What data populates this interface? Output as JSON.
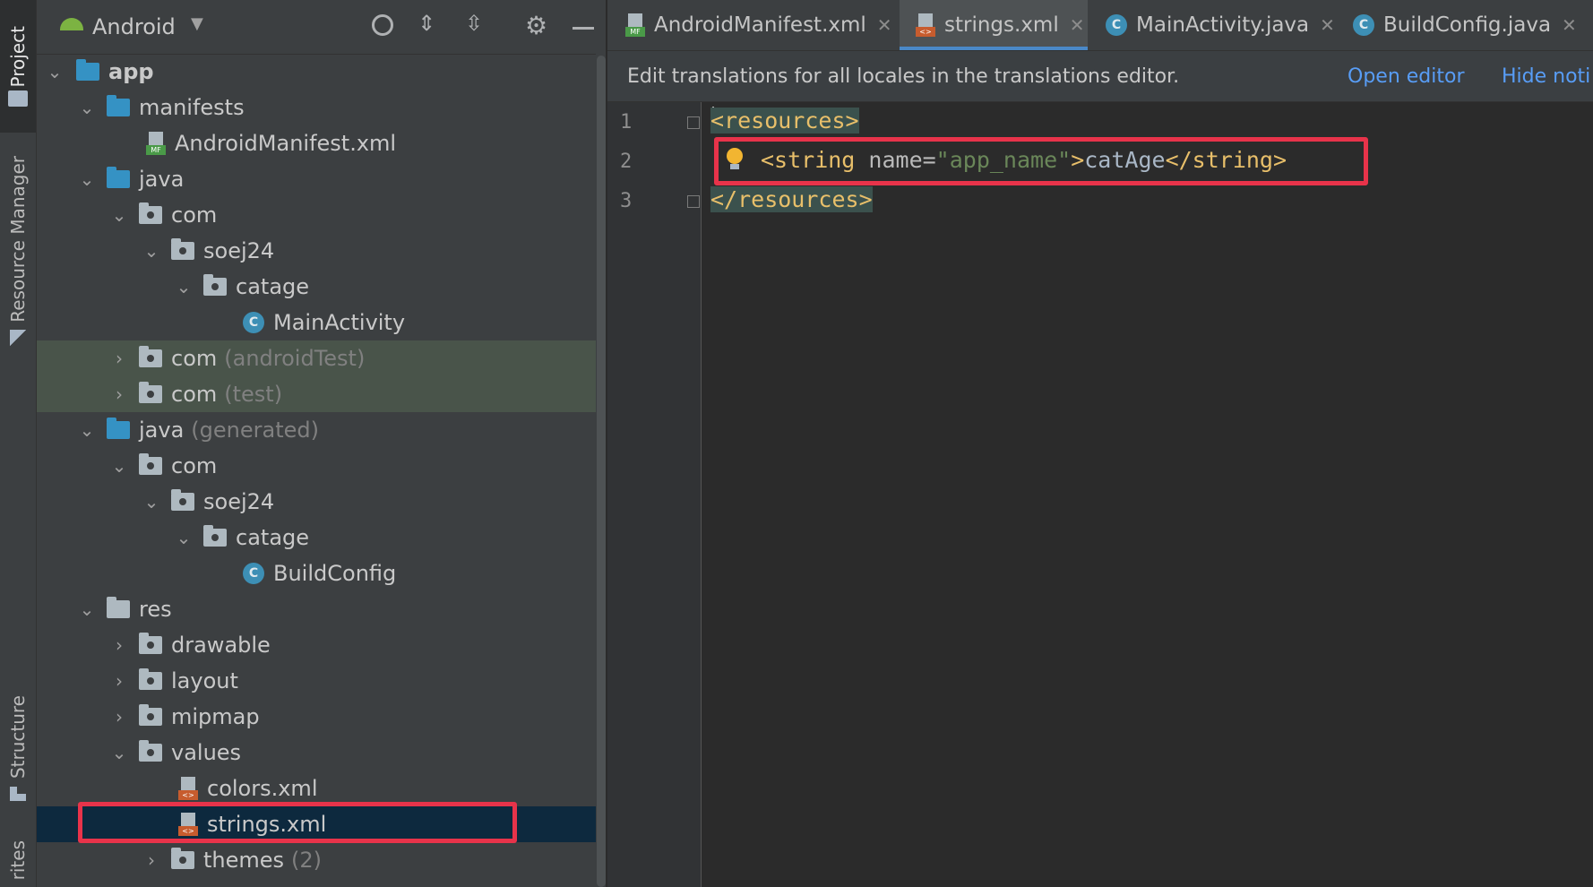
{
  "sidebar": {
    "project_tab": "Project",
    "resource_manager_tab": "Resource Manager",
    "structure_tab": "Structure",
    "favorites_tab": "rites"
  },
  "project_panel": {
    "view_selector": "Android",
    "toolbar_icons": [
      "locate-icon",
      "expand-all-icon",
      "collapse-all-icon",
      "gear-icon",
      "minimize-icon"
    ],
    "tree": [
      {
        "label": "app",
        "expanded": true
      },
      {
        "label": "manifests",
        "expanded": true
      },
      {
        "label": "AndroidManifest.xml"
      },
      {
        "label": "java",
        "expanded": true
      },
      {
        "label": "com",
        "expanded": true
      },
      {
        "label": "soej24",
        "expanded": true
      },
      {
        "label": "catage",
        "expanded": true
      },
      {
        "label": "MainActivity"
      },
      {
        "label": "com",
        "suffix": "(androidTest)",
        "expanded": false
      },
      {
        "label": "com",
        "suffix": "(test)",
        "expanded": false
      },
      {
        "label": "java",
        "suffix": "(generated)",
        "expanded": true
      },
      {
        "label": "com",
        "expanded": true
      },
      {
        "label": "soej24",
        "expanded": true
      },
      {
        "label": "catage",
        "expanded": true
      },
      {
        "label": "BuildConfig"
      },
      {
        "label": "res",
        "expanded": true
      },
      {
        "label": "drawable",
        "expanded": false
      },
      {
        "label": "layout",
        "expanded": false
      },
      {
        "label": "mipmap",
        "expanded": false
      },
      {
        "label": "values",
        "expanded": true
      },
      {
        "label": "colors.xml"
      },
      {
        "label": "strings.xml",
        "selected": true
      },
      {
        "label": "themes",
        "suffix": "(2)",
        "expanded": false
      }
    ]
  },
  "editor": {
    "tabs": [
      {
        "label": "AndroidManifest.xml",
        "active": false
      },
      {
        "label": "strings.xml",
        "active": true
      },
      {
        "label": "MainActivity.java",
        "active": false
      },
      {
        "label": "BuildConfig.java",
        "active": false
      }
    ],
    "notification": {
      "text": "Edit translations for all locales in the translations editor.",
      "open_editor": "Open editor",
      "hide": "Hide noti"
    },
    "line_numbers": [
      "1",
      "2",
      "3"
    ],
    "code": {
      "line1_tag": "<resources>",
      "line2_open": "<string",
      "line2_attr": " name=",
      "line2_val": "\"app_name\"",
      "line2_gt": ">",
      "line2_text": "catAge",
      "line2_close": "</string>",
      "line3_tag": "</resources>"
    }
  },
  "colors": {
    "highlight_box": "#e8334a",
    "selection": "#0d293e",
    "accent": "#4a88c7"
  }
}
